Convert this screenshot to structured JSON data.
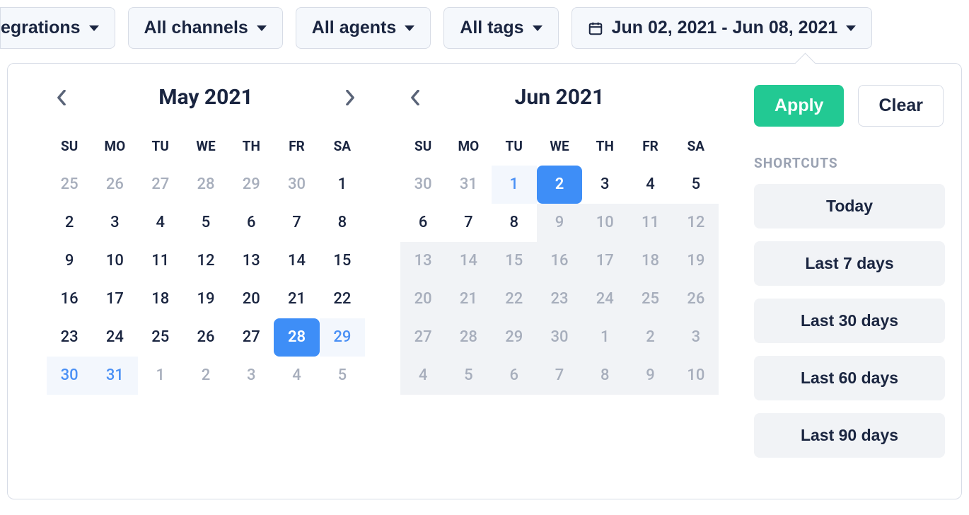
{
  "filters": {
    "integrations": "egrations",
    "channels": "All channels",
    "agents": "All agents",
    "tags": "All tags",
    "date_range": "Jun 02, 2021 - Jun 08, 2021"
  },
  "calendar": {
    "dow": [
      "SU",
      "MO",
      "TU",
      "WE",
      "TH",
      "FR",
      "SA"
    ],
    "left": {
      "title": "May 2021",
      "days": [
        {
          "n": "25",
          "cls": "outside"
        },
        {
          "n": "26",
          "cls": "outside"
        },
        {
          "n": "27",
          "cls": "outside"
        },
        {
          "n": "28",
          "cls": "outside"
        },
        {
          "n": "29",
          "cls": "outside"
        },
        {
          "n": "30",
          "cls": "outside"
        },
        {
          "n": "1",
          "cls": ""
        },
        {
          "n": "2",
          "cls": ""
        },
        {
          "n": "3",
          "cls": ""
        },
        {
          "n": "4",
          "cls": ""
        },
        {
          "n": "5",
          "cls": ""
        },
        {
          "n": "6",
          "cls": ""
        },
        {
          "n": "7",
          "cls": ""
        },
        {
          "n": "8",
          "cls": ""
        },
        {
          "n": "9",
          "cls": ""
        },
        {
          "n": "10",
          "cls": ""
        },
        {
          "n": "11",
          "cls": ""
        },
        {
          "n": "12",
          "cls": ""
        },
        {
          "n": "13",
          "cls": ""
        },
        {
          "n": "14",
          "cls": ""
        },
        {
          "n": "15",
          "cls": ""
        },
        {
          "n": "16",
          "cls": ""
        },
        {
          "n": "17",
          "cls": ""
        },
        {
          "n": "18",
          "cls": ""
        },
        {
          "n": "19",
          "cls": ""
        },
        {
          "n": "20",
          "cls": ""
        },
        {
          "n": "21",
          "cls": ""
        },
        {
          "n": "22",
          "cls": ""
        },
        {
          "n": "23",
          "cls": ""
        },
        {
          "n": "24",
          "cls": ""
        },
        {
          "n": "25",
          "cls": ""
        },
        {
          "n": "26",
          "cls": ""
        },
        {
          "n": "27",
          "cls": ""
        },
        {
          "n": "28",
          "cls": "selected"
        },
        {
          "n": "29",
          "cls": "range-light"
        },
        {
          "n": "30",
          "cls": "range-light"
        },
        {
          "n": "31",
          "cls": "range-light"
        },
        {
          "n": "1",
          "cls": "outside"
        },
        {
          "n": "2",
          "cls": "outside"
        },
        {
          "n": "3",
          "cls": "outside"
        },
        {
          "n": "4",
          "cls": "outside"
        },
        {
          "n": "5",
          "cls": "outside"
        }
      ]
    },
    "right": {
      "title": "Jun 2021",
      "days": [
        {
          "n": "30",
          "cls": "outside"
        },
        {
          "n": "31",
          "cls": "outside"
        },
        {
          "n": "1",
          "cls": "range-light"
        },
        {
          "n": "2",
          "cls": "selected"
        },
        {
          "n": "3",
          "cls": ""
        },
        {
          "n": "4",
          "cls": ""
        },
        {
          "n": "5",
          "cls": ""
        },
        {
          "n": "6",
          "cls": ""
        },
        {
          "n": "7",
          "cls": ""
        },
        {
          "n": "8",
          "cls": ""
        },
        {
          "n": "9",
          "cls": "disabled"
        },
        {
          "n": "10",
          "cls": "disabled"
        },
        {
          "n": "11",
          "cls": "disabled"
        },
        {
          "n": "12",
          "cls": "disabled"
        },
        {
          "n": "13",
          "cls": "disabled"
        },
        {
          "n": "14",
          "cls": "disabled"
        },
        {
          "n": "15",
          "cls": "disabled"
        },
        {
          "n": "16",
          "cls": "disabled"
        },
        {
          "n": "17",
          "cls": "disabled"
        },
        {
          "n": "18",
          "cls": "disabled"
        },
        {
          "n": "19",
          "cls": "disabled"
        },
        {
          "n": "20",
          "cls": "disabled"
        },
        {
          "n": "21",
          "cls": "disabled"
        },
        {
          "n": "22",
          "cls": "disabled"
        },
        {
          "n": "23",
          "cls": "disabled"
        },
        {
          "n": "24",
          "cls": "disabled"
        },
        {
          "n": "25",
          "cls": "disabled"
        },
        {
          "n": "26",
          "cls": "disabled"
        },
        {
          "n": "27",
          "cls": "disabled"
        },
        {
          "n": "28",
          "cls": "disabled"
        },
        {
          "n": "29",
          "cls": "disabled"
        },
        {
          "n": "30",
          "cls": "disabled"
        },
        {
          "n": "1",
          "cls": "disabled"
        },
        {
          "n": "2",
          "cls": "disabled"
        },
        {
          "n": "3",
          "cls": "disabled"
        },
        {
          "n": "4",
          "cls": "disabled"
        },
        {
          "n": "5",
          "cls": "disabled"
        },
        {
          "n": "6",
          "cls": "disabled"
        },
        {
          "n": "7",
          "cls": "disabled"
        },
        {
          "n": "8",
          "cls": "disabled"
        },
        {
          "n": "9",
          "cls": "disabled"
        },
        {
          "n": "10",
          "cls": "disabled"
        }
      ]
    }
  },
  "actions": {
    "apply": "Apply",
    "clear": "Clear",
    "shortcuts_label": "SHORTCUTS",
    "shortcuts": [
      "Today",
      "Last 7 days",
      "Last 30 days",
      "Last 60 days",
      "Last 90 days"
    ]
  }
}
